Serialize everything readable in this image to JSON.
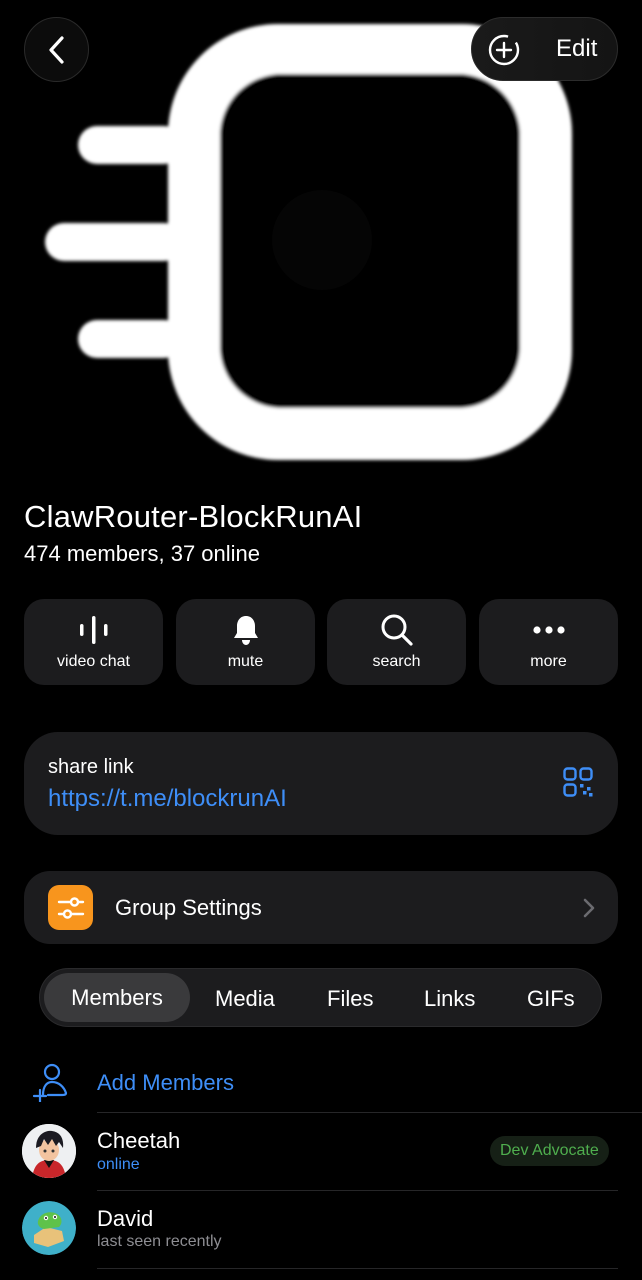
{
  "header": {
    "back_icon": "chevron-left-icon",
    "edit_label": "Edit",
    "edit_icon": "add-circle-icon"
  },
  "group": {
    "title": "ClawRouter-BlockRunAI",
    "subtitle": "474 members, 37 online",
    "logo": "clawrouter-logo"
  },
  "actions": [
    {
      "label": "video chat",
      "icon": "video-chat-icon"
    },
    {
      "label": "mute",
      "icon": "bell-icon"
    },
    {
      "label": "search",
      "icon": "search-icon"
    },
    {
      "label": "more",
      "icon": "more-dots-icon"
    }
  ],
  "share": {
    "caption": "share link",
    "url": "https://t.me/blockrunAI",
    "icon": "qr-code-icon"
  },
  "settings": {
    "label": "Group Settings",
    "icon": "sliders-icon",
    "icon_color": "#f8951d"
  },
  "tabs": [
    {
      "label": "Members",
      "active": true
    },
    {
      "label": "Media"
    },
    {
      "label": "Files"
    },
    {
      "label": "Links"
    },
    {
      "label": "GIFs"
    }
  ],
  "members": {
    "add_label": "Add Members",
    "list": [
      {
        "name": "Cheetah",
        "status": "online",
        "badge": "Dev Advocate"
      },
      {
        "name": "David",
        "status": "last seen recently"
      }
    ]
  },
  "colors": {
    "accent": "#3e8ef7",
    "background": "#000000",
    "card": "#1c1c1e",
    "badge_text": "#4fae4e"
  }
}
